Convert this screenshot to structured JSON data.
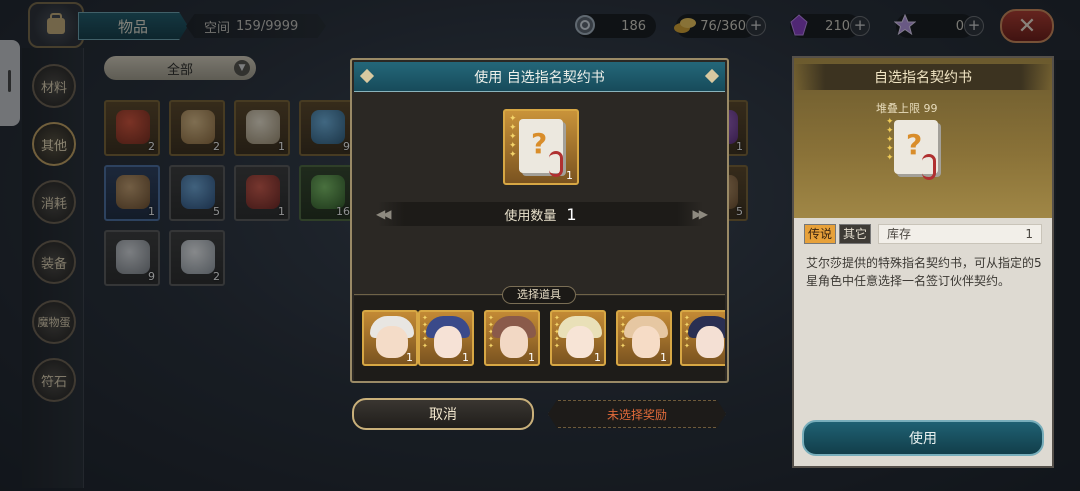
{
  "topbar": {
    "title": "物品",
    "space_label": "空间",
    "space_value": "159/9999",
    "resources": [
      {
        "icon": "spiral-icon",
        "value": "186"
      },
      {
        "icon": "gold-coins-icon",
        "value": "76/360"
      },
      {
        "icon": "purple-crystal-icon",
        "value": "210"
      },
      {
        "icon": "star-gem-icon",
        "value": "0"
      }
    ],
    "plus": "+",
    "close": "✕"
  },
  "sidebar": {
    "items": [
      {
        "label": "材料"
      },
      {
        "label": "其他"
      },
      {
        "label": "消耗"
      },
      {
        "label": "装备"
      },
      {
        "label": "魔物蛋"
      },
      {
        "label": "符石"
      }
    ],
    "active": 1
  },
  "inventory": {
    "filter": "全部",
    "items": [
      {
        "icon": "amulet-icon",
        "count": "2"
      },
      {
        "icon": "leather-pack-icon",
        "count": "2"
      },
      {
        "icon": "scroll-bundle-icon",
        "count": "1"
      },
      {
        "icon": "blue-pendant-icon",
        "count": "9"
      },
      {
        "icon": "sack-icon",
        "count": "1"
      },
      {
        "icon": "blue-ore-icon",
        "count": "5"
      },
      {
        "icon": "red-ore-icon",
        "count": "1"
      },
      {
        "icon": "green-ore-icon",
        "count": "16"
      },
      {
        "icon": "silver-pouch-icon",
        "count": "9"
      },
      {
        "icon": "white-pouch-icon",
        "count": "2"
      },
      {
        "icon": "purple-item-icon",
        "count": "1"
      },
      {
        "icon": "sack-icon",
        "count": "5"
      }
    ]
  },
  "dialog": {
    "title": "使用 自选指名契约书",
    "item_count": "1",
    "qty_label": "使用数量",
    "qty_value": "1",
    "choose_label": "选择道具",
    "heroes": [
      {
        "count": "1"
      },
      {
        "count": "1"
      },
      {
        "count": "1"
      },
      {
        "count": "1"
      },
      {
        "count": "1"
      },
      {
        "count": "1"
      }
    ],
    "cancel": "取消",
    "no_reward": "未选择奖励"
  },
  "detail": {
    "title": "自选指名契约书",
    "stack_limit": "堆叠上限 99",
    "tag_legend": "传说",
    "tag_other": "其它",
    "stock_label": "库存",
    "stock_value": "1",
    "description": "艾尔莎提供的特殊指名契约书，可从指定的5星角色中任意选择一名签订伙伴契约。",
    "use": "使用"
  },
  "colors": {
    "accent_teal": "#1f6173",
    "gold_border": "#d7a744",
    "warning": "#e06a3a"
  }
}
